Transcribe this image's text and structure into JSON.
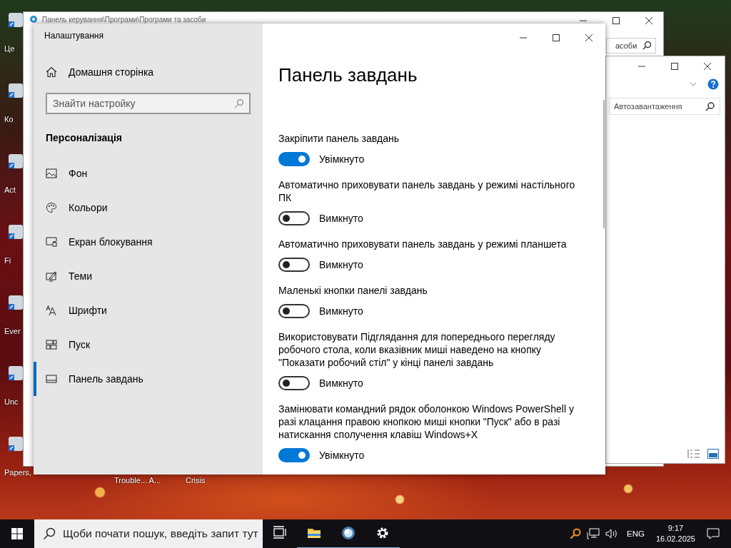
{
  "desktop": {
    "left_icons": [
      {
        "label": "Це"
      },
      {
        "label": "Ко"
      },
      {
        "label": "Act"
      },
      {
        "label": "Fi"
      },
      {
        "label": "Ever"
      },
      {
        "label": "Unc"
      },
      {
        "label": "Papers,"
      }
    ],
    "bottom_icons": [
      {
        "label": "Trouble... A..."
      },
      {
        "label": "Crisis"
      }
    ]
  },
  "control_panel_window": {
    "title": "Панель керування\\Програми\\Програми та засоби",
    "search_text": "асоби"
  },
  "explorer_window": {
    "search_text": "Автозавантаження"
  },
  "settings_window": {
    "title": "Налаштування",
    "sidebar": {
      "home": "Домашня сторінка",
      "search": {
        "placeholder": "Знайти настройку"
      },
      "section": "Персоналізація",
      "items": [
        {
          "label": "Фон",
          "kind": "background",
          "selected": false
        },
        {
          "label": "Кольори",
          "kind": "colors",
          "selected": false
        },
        {
          "label": "Екран блокування",
          "kind": "lock",
          "selected": false
        },
        {
          "label": "Теми",
          "kind": "themes",
          "selected": false
        },
        {
          "label": "Шрифти",
          "kind": "fonts",
          "selected": false
        },
        {
          "label": "Пуск",
          "kind": "start",
          "selected": false
        },
        {
          "label": "Панель завдань",
          "kind": "taskbar",
          "selected": true
        }
      ]
    },
    "page": {
      "title": "Панель завдань",
      "settings": [
        {
          "label": "Закріпити панель завдань",
          "on": true,
          "state_text": "Увімкнуто"
        },
        {
          "label": "Автоматично приховувати панель завдань у режимі настільного ПК",
          "on": false,
          "state_text": "Вимкнуто"
        },
        {
          "label": "Автоматично приховувати панель завдань у режимі планшета",
          "on": false,
          "state_text": "Вимкнуто"
        },
        {
          "label": "Маленькі кнопки панелі завдань",
          "on": false,
          "state_text": "Вимкнуто"
        },
        {
          "label": "Використовувати Підглядання для попереднього перегляду робочого стола, коли вказівник миші наведено на кнопку \"Показати робочий стіл\" у кінці панелі завдань",
          "on": false,
          "state_text": "Вимкнуто"
        },
        {
          "label": "Замінювати командний рядок оболонкою Windows PowerShell у разі клацання правою кнопкою миші кнопки \"Пуск\" або в разі натискання сполучення клавіш Windows+X",
          "on": true,
          "state_text": "Увімкнуто"
        }
      ]
    }
  },
  "taskbar": {
    "search": {
      "placeholder": "Щоби почати пошук, введіть запит тут"
    },
    "apps": [
      {
        "kind": "taskview",
        "active": false
      },
      {
        "kind": "explorer",
        "active": true
      },
      {
        "kind": "globe",
        "active": true
      },
      {
        "kind": "settings",
        "active": true
      }
    ],
    "language": "ENG",
    "time": "9:17",
    "date": "16.02.2025"
  }
}
